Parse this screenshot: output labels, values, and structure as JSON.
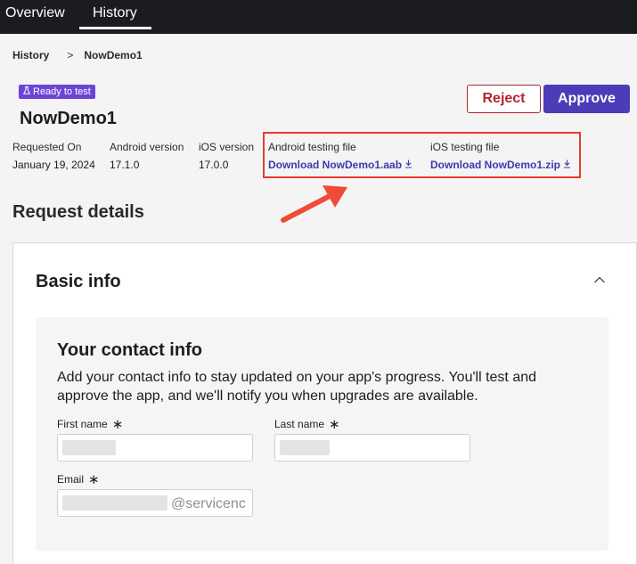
{
  "tabs": {
    "overview": "Overview",
    "history": "History"
  },
  "breadcrumb": {
    "parent": "History",
    "separator": ">",
    "current": "NowDemo1"
  },
  "status_badge": {
    "label": "Ready to test",
    "icon": "flask-icon",
    "color": "#6b45d6"
  },
  "app": {
    "name": "NowDemo1"
  },
  "actions": {
    "reject": "Reject",
    "approve": "Approve",
    "reject_color": "#b0262f",
    "approve_color": "#4a3db7"
  },
  "meta": {
    "requested_on_label": "Requested On",
    "requested_on_value": "January 19, 2024",
    "android_version_label": "Android version",
    "android_version_value": "17.1.0",
    "ios_version_label": "iOS version",
    "ios_version_value": "17.0.0",
    "android_file_label": "Android testing file",
    "android_file_link": "Download NowDemo1.aab",
    "ios_file_label": "iOS testing file",
    "ios_file_link": "Download NowDemo1.zip",
    "download_icon": "download-icon"
  },
  "annotation": {
    "highlight_color": "#e63b32",
    "arrow_color": "#ef4b36"
  },
  "request_details": {
    "title": "Request details",
    "card_title": "Basic info",
    "collapse_icon": "chevron-up-icon",
    "contact": {
      "title": "Your contact info",
      "description": "Add your contact info to stay updated on your app's progress. You'll test and approve the app, and we'll notify you when upgrades are available.",
      "first_name_label": "First name",
      "last_name_label": "Last name",
      "email_label": "Email",
      "required_marker": "∗",
      "email_visible_text": "@servicenc"
    }
  }
}
